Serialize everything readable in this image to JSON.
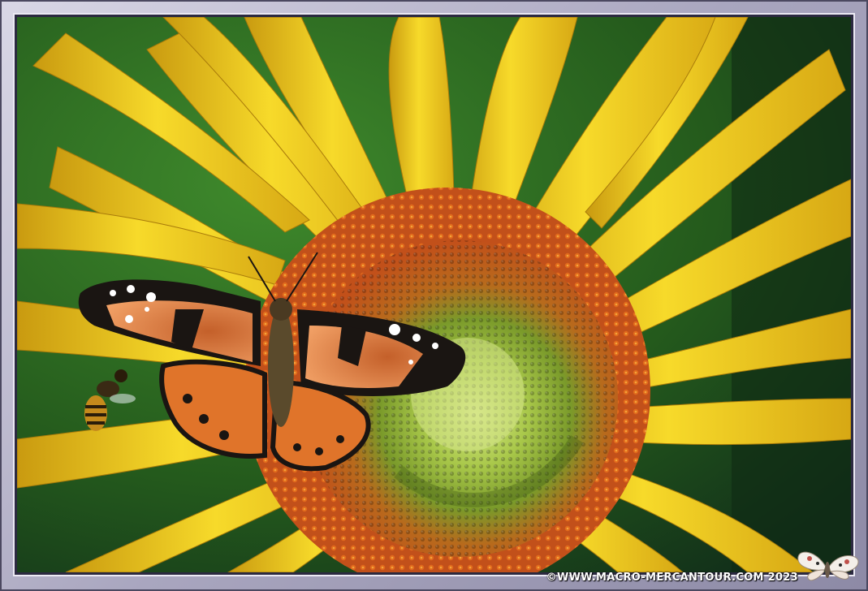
{
  "image": {
    "watermark_text": "©WWW.MACRO-MERCANTOUR.COM 2023",
    "colors": {
      "frame": "#a9a6bf",
      "frame_dark": "#2b2940",
      "background_green": "#2f6a22",
      "petal": "#f1cf1e",
      "petal_shadow": "#c99a10",
      "disk_outer": "#c8581a",
      "disk_inner": "#8fb43c",
      "disk_center": "#cfe07a",
      "butterfly_orange": "#e0742a",
      "butterfly_black": "#1a1512"
    },
    "subjects": [
      "sunflower",
      "butterfly",
      "bee",
      "logo-butterfly"
    ]
  }
}
